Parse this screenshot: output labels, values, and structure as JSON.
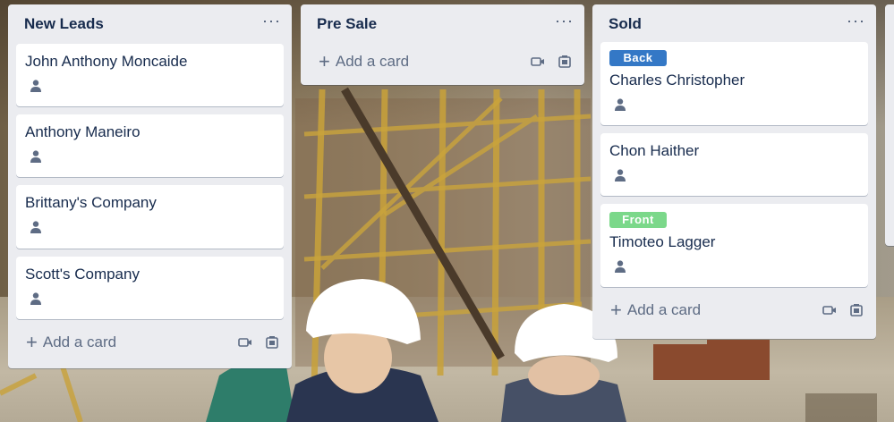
{
  "colors": {
    "list_bg": "#ebecf0",
    "label_blue": "#3478c6",
    "label_green": "#7bd88a",
    "text_primary": "#172b4d",
    "text_muted": "#5e6c84"
  },
  "lists": [
    {
      "title": "New Leads",
      "menu": "···",
      "cards": [
        {
          "title": "John Anthony Moncaide",
          "badge_icon": "person-icon"
        },
        {
          "title": "Anthony Maneiro",
          "badge_icon": "person-icon"
        },
        {
          "title": "Brittany's Company",
          "badge_icon": "person-icon"
        },
        {
          "title": "Scott's Company",
          "badge_icon": "person-icon"
        }
      ],
      "add_label": "Add a card"
    },
    {
      "title": "Pre Sale",
      "menu": "···",
      "cards": [],
      "add_label": "Add a card"
    },
    {
      "title": "Sold",
      "menu": "···",
      "cards": [
        {
          "label": "Back",
          "label_color": "#3478c6",
          "title": "Charles Christopher",
          "badge_icon": "person-icon"
        },
        {
          "title": "Chon Haither",
          "badge_icon": "person-icon"
        },
        {
          "label": "Front",
          "label_color": "#7bd88a",
          "title": "Timoteo Lagger",
          "badge_icon": "person-icon"
        }
      ],
      "add_label": "Add a card"
    }
  ]
}
